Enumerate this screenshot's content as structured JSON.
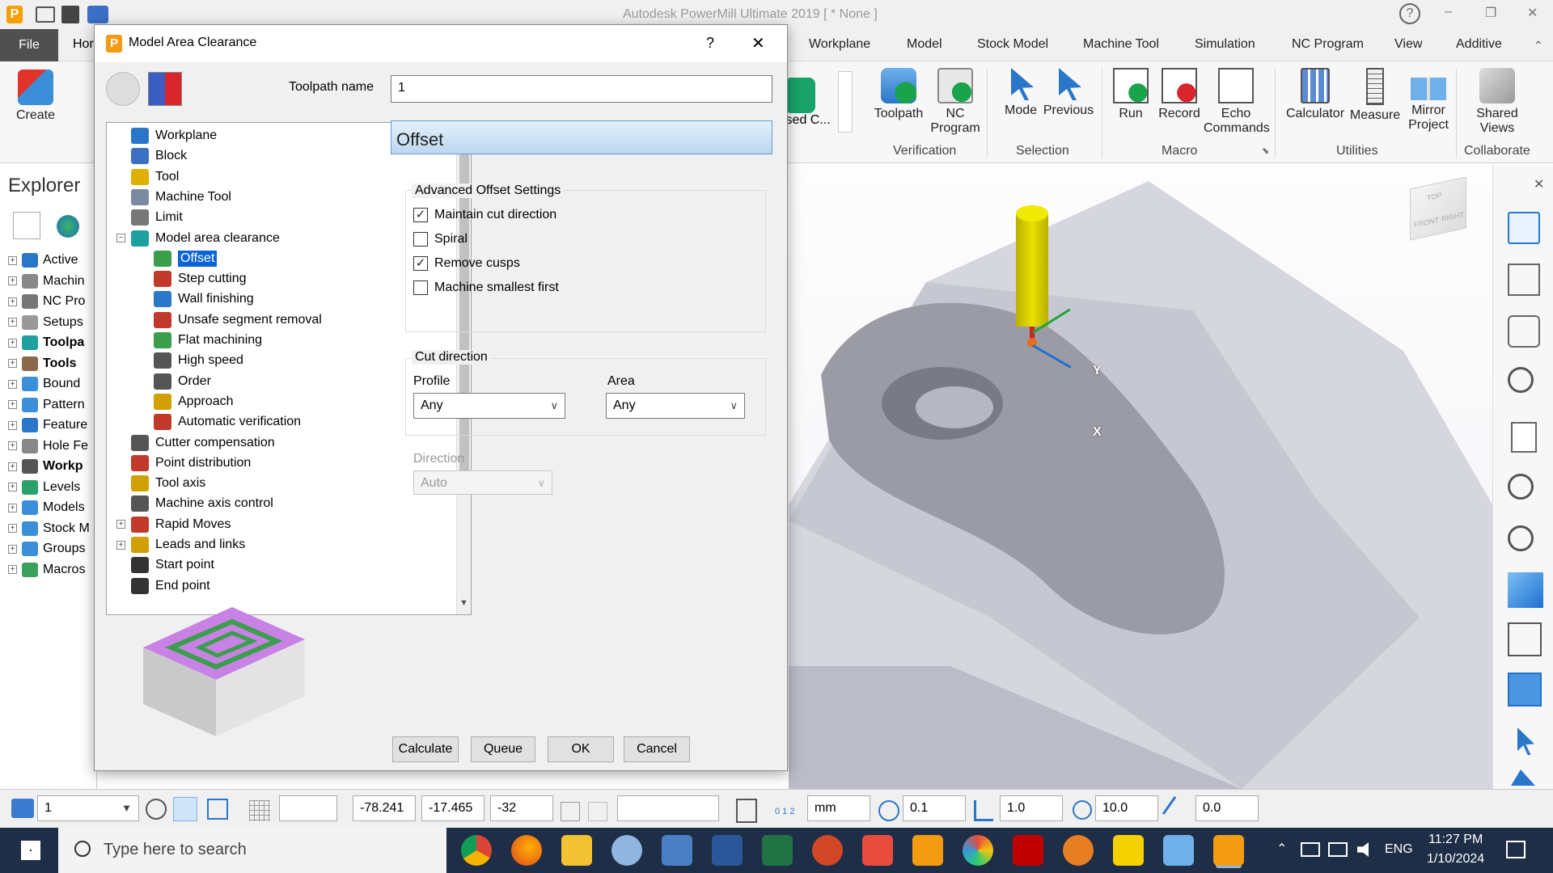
{
  "app": {
    "title": "Autodesk PowerMill Ultimate 2019    [ * None ]",
    "help_glyph": "?",
    "minimize_glyph": "–",
    "restore_glyph": "❐",
    "close_glyph": "✕"
  },
  "ribbon_tabs": [
    "File",
    "Hor",
    "Workplane",
    "Model",
    "Stock Model",
    "Machine Tool",
    "Simulation",
    "NC Program",
    "View",
    "Additive"
  ],
  "ribbon": {
    "create_label": "Create",
    "used_label": "ised C...",
    "buttons": [
      {
        "label": "Toolpath",
        "icon": "toolpath-verify-icon"
      },
      {
        "label": "NC\nProgram",
        "icon": "nc-program-verify-icon"
      },
      {
        "label": "Mode",
        "icon": "selection-mode-icon"
      },
      {
        "label": "Previous",
        "icon": "previous-selection-icon"
      },
      {
        "label": "Run",
        "icon": "run-macro-icon"
      },
      {
        "label": "Record",
        "icon": "record-macro-icon"
      },
      {
        "label": "Echo\nCommands",
        "icon": "echo-commands-icon"
      },
      {
        "label": "Calculator",
        "icon": "calculator-icon"
      },
      {
        "label": "Measure",
        "icon": "measure-icon"
      },
      {
        "label": "Mirror\nProject",
        "icon": "mirror-project-icon"
      },
      {
        "label": "Shared\nViews",
        "icon": "shared-views-icon"
      }
    ],
    "groups": [
      "Verification",
      "Selection",
      "Macro",
      "Utilities",
      "Collaborate"
    ]
  },
  "explorer": {
    "title": "Explorer",
    "items": [
      "Active",
      "Machin",
      "NC Pro",
      "Setups",
      "Toolpa",
      "Tools",
      "Bound",
      "Pattern",
      "Feature",
      "Hole Fe",
      "Workp",
      "Levels",
      "Models",
      "Stock M",
      "Groups",
      "Macros"
    ]
  },
  "dialog": {
    "title": "Model Area Clearance",
    "help": "?",
    "close": "✕",
    "toolpath_name_label": "Toolpath name",
    "toolpath_name_value": "1",
    "section_title": "Offset",
    "tree": [
      {
        "label": "Workplane",
        "indent": 0
      },
      {
        "label": "Block",
        "indent": 0
      },
      {
        "label": "Tool",
        "indent": 0
      },
      {
        "label": "Machine Tool",
        "indent": 0
      },
      {
        "label": "Limit",
        "indent": 0
      },
      {
        "label": "Model area clearance",
        "indent": 0
      },
      {
        "label": "Offset",
        "indent": 1,
        "selected": true
      },
      {
        "label": "Step cutting",
        "indent": 1
      },
      {
        "label": "Wall finishing",
        "indent": 1
      },
      {
        "label": "Unsafe segment removal",
        "indent": 1
      },
      {
        "label": "Flat machining",
        "indent": 1
      },
      {
        "label": "High speed",
        "indent": 1
      },
      {
        "label": "Order",
        "indent": 1
      },
      {
        "label": "Approach",
        "indent": 1
      },
      {
        "label": "Automatic verification",
        "indent": 1
      },
      {
        "label": "Cutter compensation",
        "indent": 0
      },
      {
        "label": "Point distribution",
        "indent": 0
      },
      {
        "label": "Tool axis",
        "indent": 0
      },
      {
        "label": "Machine axis control",
        "indent": 0
      },
      {
        "label": "Rapid Moves",
        "indent": 0
      },
      {
        "label": "Leads and links",
        "indent": 0
      },
      {
        "label": "Start point",
        "indent": 0
      },
      {
        "label": "End point",
        "indent": 0
      }
    ],
    "advanced_offset_title": "Advanced Offset Settings",
    "checkboxes": [
      {
        "label": "Maintain cut direction",
        "checked": true
      },
      {
        "label": "Spiral",
        "checked": false
      },
      {
        "label": "Remove cusps",
        "checked": true
      },
      {
        "label": "Machine smallest first",
        "checked": false
      }
    ],
    "cut_direction_title": "Cut direction",
    "profile_label": "Profile",
    "profile_value": "Any",
    "area_label": "Area",
    "area_value": "Any",
    "direction_label": "Direction",
    "direction_value": "Auto",
    "buttons": {
      "calculate": "Calculate",
      "queue": "Queue",
      "ok": "OK",
      "cancel": "Cancel"
    }
  },
  "viewport": {
    "axis_y": "Y",
    "axis_x": "X",
    "cube_faces": [
      "TOP",
      "FRONT",
      "RIGHT"
    ]
  },
  "statusbar": {
    "workplane_value": "1",
    "coord_x": "-78.241",
    "coord_y": "-17.465",
    "coord_z": "-32",
    "units_label": "0 1 2",
    "units": "mm",
    "tolerance": "0.1",
    "thickness": "1.0",
    "diameter": "10.0",
    "stepover": "0.0"
  },
  "taskbar": {
    "search_placeholder": "Type here to search",
    "language": "ENG",
    "time": "11:27 PM",
    "date": "1/10/2024"
  },
  "colors": {
    "accent": "#0a64d2",
    "section_header": "#cfe4f7",
    "taskbar": "#1f2e47",
    "tool_yellow": "#d4cc00",
    "model_gray": "#b8b8c2"
  }
}
